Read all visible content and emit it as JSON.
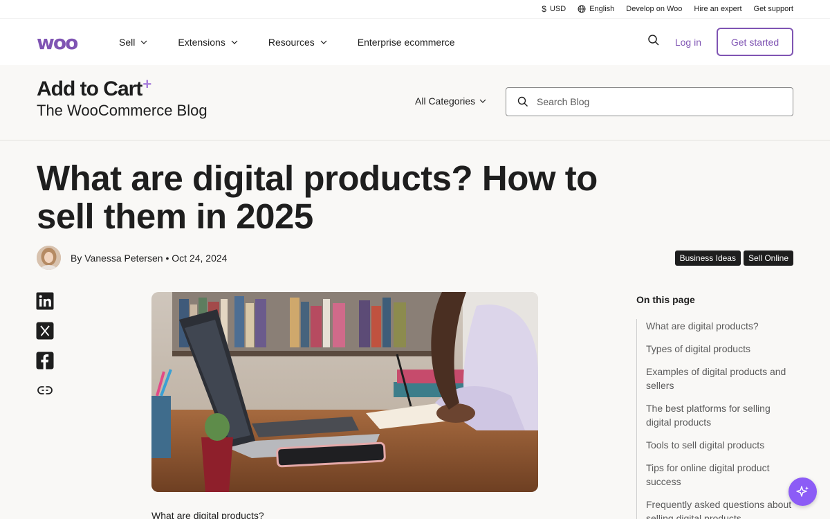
{
  "util_bar": {
    "currency": "USD",
    "language": "English",
    "develop": "Develop on Woo",
    "hire": "Hire an expert",
    "support": "Get support"
  },
  "nav": {
    "logo_text": "woo",
    "items": [
      "Sell",
      "Extensions",
      "Resources",
      "Enterprise ecommerce"
    ],
    "login": "Log in",
    "get_started": "Get started"
  },
  "blog": {
    "brand_title": "Add to Cart",
    "brand_plus": "+",
    "brand_subtitle": "The WooCommerce Blog",
    "categories": "All Categories",
    "search_placeholder": "Search Blog"
  },
  "article": {
    "title": "What are digital products? How to sell them in 2025",
    "byline": "By Vanessa Petersen • Oct 24, 2024",
    "tags": [
      "Business Ideas",
      "Sell Online"
    ],
    "body_start": "What are digital products?"
  },
  "toc": {
    "heading": "On this page",
    "items": [
      "What are digital products?",
      "Types of digital products",
      "Examples of digital products and sellers",
      "The best platforms for selling digital products",
      "Tools to sell digital products",
      "Tips for online digital product success",
      "Frequently asked questions about selling digital products"
    ]
  },
  "colors": {
    "brand_purple": "#7f54b3",
    "fab_purple": "#8c5cf6",
    "band_bg": "#f9f8f6"
  },
  "icons": [
    "dollar-icon",
    "globe-icon",
    "search-icon",
    "chevron-down-icon",
    "linkedin-icon",
    "x-icon",
    "facebook-icon",
    "link-icon",
    "sparkle-icon"
  ]
}
